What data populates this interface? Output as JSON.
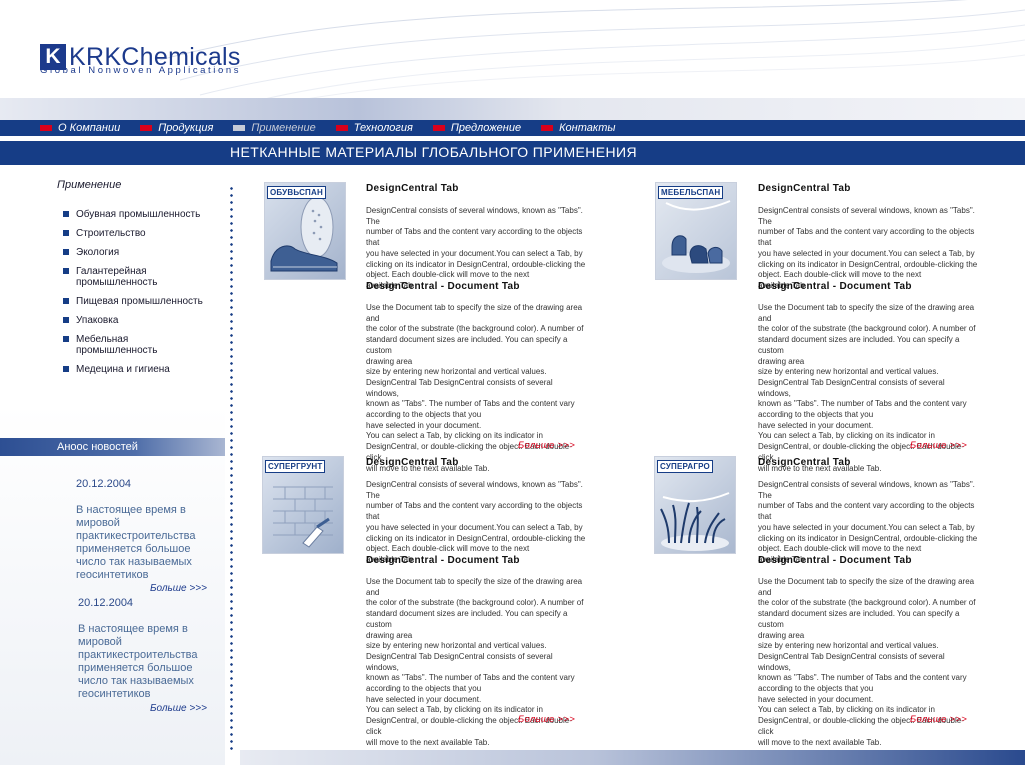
{
  "header": {
    "logo_mark": "K",
    "logo_text": "KRKChemicals",
    "tagline": "Global Nonwoven Applications"
  },
  "nav": {
    "items": [
      {
        "label": "О Компании",
        "active": false
      },
      {
        "label": "Продукция",
        "active": false
      },
      {
        "label": "Применение",
        "active": true
      },
      {
        "label": "Технология",
        "active": false
      },
      {
        "label": "Предложение",
        "active": false
      },
      {
        "label": "Контакты",
        "active": false
      }
    ]
  },
  "page": {
    "title": "НЕТКАННЫЕ МАТЕРИАЛЫ ГЛОБАЛЬНОГО ПРИМЕНЕНИЯ"
  },
  "sidebar": {
    "title": "Применение",
    "items": [
      "Обувная промышленность",
      "Строительство",
      "Экология",
      "Галантерейная промышленность",
      "Пищевая промышленность",
      "Упаковка",
      "Мебельная промышленность",
      "Медецина и гигиена"
    ]
  },
  "news": {
    "heading": "Аноос новостей",
    "items": [
      {
        "date": "20.12.2004",
        "text": "В настоящее время в мировой практикестроительства применяется большое число так называемых геосинтетиков",
        "more": "Больше >>>"
      },
      {
        "date": "20.12.2004",
        "text": "В настоящее время в мировой практикестроительства применяется большое число так называемых геосинтетиков",
        "more": "Больше >>>"
      }
    ]
  },
  "products": [
    {
      "badge": "ОБУВЬСПАН",
      "title1": "DesignCentral Tab",
      "body1": "DesignCentral consists of several windows, known as \"Tabs\". The\nnumber of Tabs and the content vary according to the objects that\nyou have selected in your document.You can select a Tab, by\nclicking on its indicator in DesignCentral, ordouble-clicking the\nobject. Each double-click will move to the next\navailable Tab.",
      "title2": "DesignCentral - Document Tab",
      "body2": "Use the Document tab to specify the size of the drawing area and\nthe color of the substrate (the background color). A number of\nstandard document sizes are included. You can specify a custom\ndrawing area\nsize by entering new horizontal and vertical values.\nDesignCentral Tab DesignCentral consists of several windows,\nknown as \"Tabs\". The number of Tabs and the content vary\naccording to the objects that you\nhave selected in your document.\nYou can select a Tab, by clicking on its indicator in\nDesignCentral, or double-clicking the object. Each double-click\nwill move to the next available Tab.",
      "more": "Больше >>>"
    },
    {
      "badge": "МЕБЕЛЬСПАН",
      "title1": "DesignCentral Tab",
      "body1": "DesignCentral consists of several windows, known as \"Tabs\". The\nnumber of Tabs and the content vary according to the objects that\nyou have selected in your document.You can select a Tab, by\nclicking on its indicator in DesignCentral, ordouble-clicking the\nobject. Each double-click will move to the next\navailable Tab.",
      "title2": "DesignCentral - Document Tab",
      "body2": "Use the Document tab to specify the size of the drawing area and\nthe color of the substrate (the background color). A number of\nstandard document sizes are included. You can specify a custom\ndrawing area\nsize by entering new horizontal and vertical values.\nDesignCentral Tab DesignCentral consists of several windows,\nknown as \"Tabs\". The number of Tabs and the content vary\naccording to the objects that you\nhave selected in your document.\nYou can select a Tab, by clicking on its indicator in\nDesignCentral, or double-clicking the object. Each double-click\nwill move to the next available Tab.",
      "more": "Больше >>>"
    },
    {
      "badge": "СУПЕРГРУНТ",
      "title1": "DesignCentral Tab",
      "body1": "DesignCentral consists of several windows, known as \"Tabs\". The\nnumber of Tabs and the content vary according to the objects that\nyou have selected in your document.You can select a Tab, by\nclicking on its indicator in DesignCentral, ordouble-clicking the\nobject. Each double-click will move to the next\navailable Tab.",
      "title2": "DesignCentral - Document Tab",
      "body2": "Use the Document tab to specify the size of the drawing area and\nthe color of the substrate (the background color). A number of\nstandard document sizes are included. You can specify a custom\ndrawing area\nsize by entering new horizontal and vertical values.\nDesignCentral Tab DesignCentral consists of several windows,\nknown as \"Tabs\". The number of Tabs and the content vary\naccording to the objects that you\nhave selected in your document.\nYou can select a Tab, by clicking on its indicator in\nDesignCentral, or double-clicking the object. Each double-click\nwill move to the next available Tab.",
      "more": "Больше >>>"
    },
    {
      "badge": "СУПЕРАГРО",
      "title1": "DesignCentral Tab",
      "body1": "DesignCentral consists of several windows, known as \"Tabs\". The\nnumber of Tabs and the content vary according to the objects that\nyou have selected in your document.You can select a Tab, by\nclicking on its indicator in DesignCentral, ordouble-clicking the\nobject. Each double-click will move to the next\navailable Tab.",
      "title2": "DesignCentral - Document Tab",
      "body2": "Use the Document tab to specify the size of the drawing area and\nthe color of the substrate (the background color). A number of\nstandard document sizes are included. You can specify a custom\ndrawing area\nsize by entering new horizontal and vertical values.\nDesignCentral Tab DesignCentral consists of several windows,\nknown as \"Tabs\". The number of Tabs and the content vary\naccording to the objects that you\nhave selected in your document.\nYou can select a Tab, by clicking on its indicator in\nDesignCentral, or double-clicking the object. Each double-click\nwill move to the next available Tab.",
      "more": "Больше >>>"
    }
  ],
  "colors": {
    "brand_blue": "#163d86",
    "accent_red": "#d9001b"
  }
}
